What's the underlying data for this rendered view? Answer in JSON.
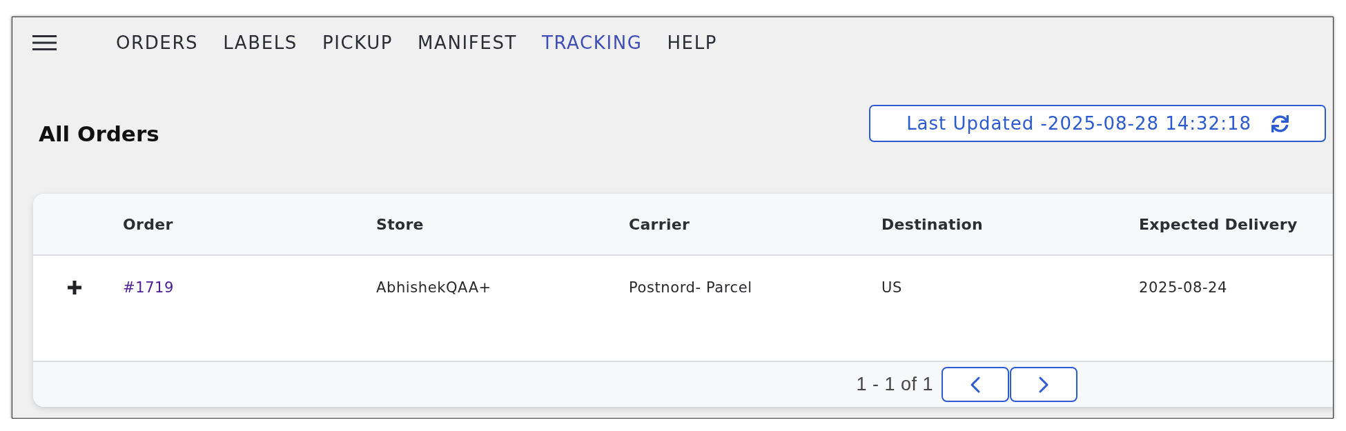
{
  "nav": {
    "items": [
      {
        "label": "ORDERS",
        "selected": false
      },
      {
        "label": "LABELS",
        "selected": false
      },
      {
        "label": "PICKUP",
        "selected": false
      },
      {
        "label": "MANIFEST",
        "selected": false
      },
      {
        "label": "TRACKING",
        "selected": true
      },
      {
        "label": "HELP",
        "selected": false
      }
    ]
  },
  "header": {
    "title": "All Orders",
    "last_updated": "Last Updated -2025-08-28 14:32:18"
  },
  "table": {
    "columns": [
      "Order",
      "Store",
      "Carrier",
      "Destination",
      "Expected Delivery"
    ],
    "rows": [
      {
        "expanded": false,
        "cells": [
          "#1719",
          "AbhishekQAA+",
          "Postnord- Parcel",
          "US",
          "2025-08-24"
        ]
      }
    ]
  },
  "pagination": {
    "range": "1 - 1 of 1"
  }
}
